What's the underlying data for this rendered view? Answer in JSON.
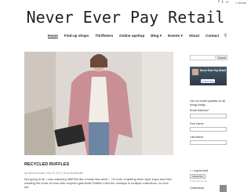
{
  "site": {
    "title": "Never Ever Pay Retail"
  },
  "topbar": {
    "social_icons": [
      "facebook-icon",
      "twitter-icon",
      "rss-icon"
    ],
    "social_glyphs": [
      "f",
      "t",
      "≈"
    ],
    "home_label": "Home"
  },
  "nav": {
    "items": [
      "Home",
      "Find-up shops",
      "Thriftsters",
      "Online opshop",
      "Blog",
      "Events",
      "About",
      "Contact"
    ],
    "dropdown_marks": [
      "",
      "",
      "",
      "",
      "▾",
      "▾",
      "",
      ""
    ]
  },
  "post": {
    "title": "RECYCLED RUFFLES",
    "meta": "by Hannah Kirwan | Feb 22, 2017 | Shop Sustainable",
    "excerpt": "Not going to lie, I was watching MBFWA like a hawk last week... I'm a fan of getting fresh style inspo and then creating the looks for less with recycled garments! Ruffles ruled the runways in multiple collections, so here are"
  },
  "sidebar": {
    "search_placeholder": "",
    "search_button": "Search",
    "fb_page_name": "Never Ever Pay Retail",
    "fb_button": "Follow Page",
    "signup_text": "Get our email updates on all things thrifty...",
    "email_label": "Email Address*",
    "first_name_label": "First Name",
    "last_name_label": "Last Name",
    "required_note": "* = required field",
    "subscribe_button": "Subscribe",
    "subscribe_sub": "unsubscribe from list",
    "online_shop_label": "Onlineshop"
  },
  "colors": {
    "hero_jacket": "#c98f94",
    "hero_bg": "#ddd8d3",
    "text_dark": "#222222"
  }
}
